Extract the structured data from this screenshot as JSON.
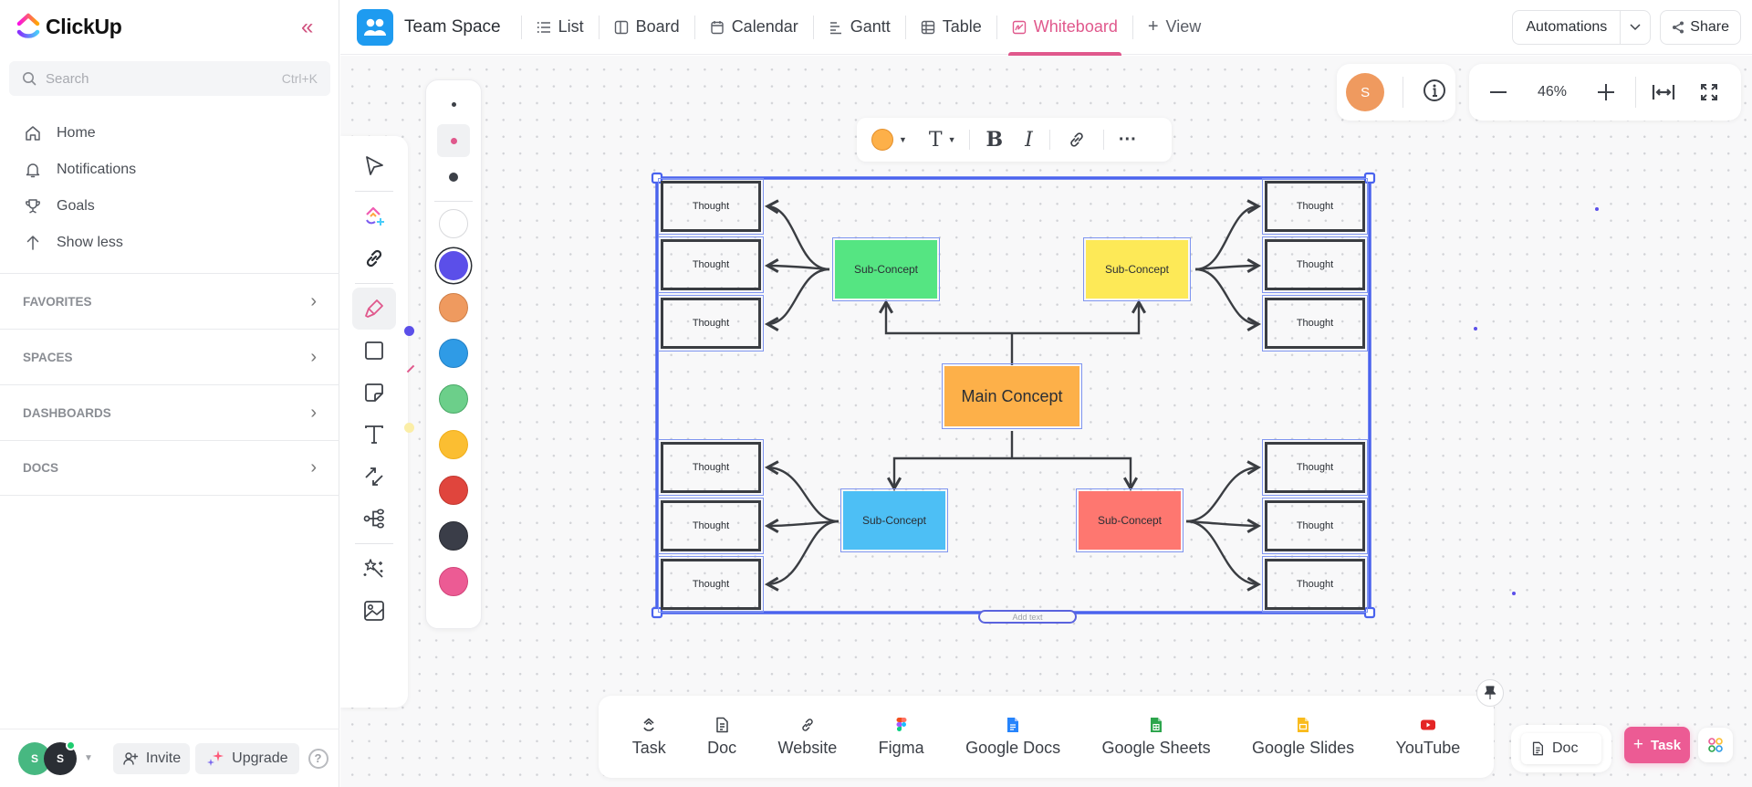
{
  "sidebar": {
    "logo_text": "ClickUp",
    "search": {
      "placeholder": "Search",
      "shortcut": "Ctrl+K"
    },
    "nav": [
      {
        "label": "Home",
        "icon": "home-icon"
      },
      {
        "label": "Notifications",
        "icon": "bell-icon"
      },
      {
        "label": "Goals",
        "icon": "trophy-icon"
      },
      {
        "label": "Show less",
        "icon": "arrow-up-icon"
      }
    ],
    "sections": [
      {
        "label": "FAVORITES"
      },
      {
        "label": "SPACES"
      },
      {
        "label": "DASHBOARDS"
      },
      {
        "label": "DOCS"
      }
    ],
    "footer": {
      "avatars": [
        {
          "initial": "S",
          "color": "#47b881"
        },
        {
          "initial": "S",
          "color": "#2a2e34"
        }
      ],
      "invite_label": "Invite",
      "upgrade_label": "Upgrade"
    }
  },
  "header": {
    "space_name": "Team Space",
    "tabs": [
      {
        "label": "List",
        "icon": "list-icon",
        "active": false
      },
      {
        "label": "Board",
        "icon": "board-icon",
        "active": false
      },
      {
        "label": "Calendar",
        "icon": "calendar-icon",
        "active": false
      },
      {
        "label": "Gantt",
        "icon": "gantt-icon",
        "active": false
      },
      {
        "label": "Table",
        "icon": "table-icon",
        "active": false
      },
      {
        "label": "Whiteboard",
        "icon": "whiteboard-icon",
        "active": true
      }
    ],
    "add_view_label": "View",
    "automations_label": "Automations",
    "share_label": "Share",
    "accent": "#e0588c"
  },
  "canvas": {
    "user_avatar_initial": "S",
    "zoom_level": "46%",
    "toolbar_tools": [
      "select-tool",
      "clickup-ai-add-tool",
      "link-tool",
      "pen-tool",
      "shape-tool",
      "sticky-note-tool",
      "text-tool",
      "connector-tool",
      "mind-map-tool",
      "ai-magic-tool",
      "image-tool"
    ],
    "pen_sizes": [
      "small",
      "medium",
      "large"
    ],
    "pen_selected_size": "medium",
    "colors": [
      "#ffffff",
      "#5b4fe9",
      "#ef9a5f",
      "#2f9be6",
      "#6ccf8a",
      "#fbbe32",
      "#e0453d",
      "#3a3d48",
      "#ec5b94"
    ],
    "selected_color": "#5b4fe9",
    "format_toolbar": {
      "fill_color": "#fdb049"
    },
    "selection_label": "Add text"
  },
  "diagram": {
    "main": {
      "label": "Main Concept",
      "color": "#fdb049"
    },
    "subs": [
      {
        "label": "Sub-Concept",
        "color": "#55e582",
        "position": "top-left"
      },
      {
        "label": "Sub-Concept",
        "color": "#fde957",
        "position": "top-right"
      },
      {
        "label": "Sub-Concept",
        "color": "#4dbff5",
        "position": "bottom-left"
      },
      {
        "label": "Sub-Concept",
        "color": "#fe7770",
        "position": "bottom-right"
      }
    ],
    "thoughts": {
      "top_left": [
        "Thought",
        "Thought",
        "Thought"
      ],
      "top_right": [
        "Thought",
        "Thought",
        "Thought"
      ],
      "bottom_left": [
        "Thought",
        "Thought",
        "Thought"
      ],
      "bottom_right": [
        "Thought",
        "Thought",
        "Thought"
      ]
    }
  },
  "dock": {
    "items": [
      {
        "label": "Task",
        "icon": "task-icon"
      },
      {
        "label": "Doc",
        "icon": "doc-icon"
      },
      {
        "label": "Website",
        "icon": "link-icon"
      },
      {
        "label": "Figma",
        "icon": "figma-icon"
      },
      {
        "label": "Google Docs",
        "icon": "google-docs-icon"
      },
      {
        "label": "Google Sheets",
        "icon": "google-sheets-icon"
      },
      {
        "label": "Google Slides",
        "icon": "google-slides-icon"
      },
      {
        "label": "YouTube",
        "icon": "youtube-icon"
      }
    ]
  },
  "bottom_right": {
    "doc_label": "Doc",
    "task_label": "Task"
  }
}
